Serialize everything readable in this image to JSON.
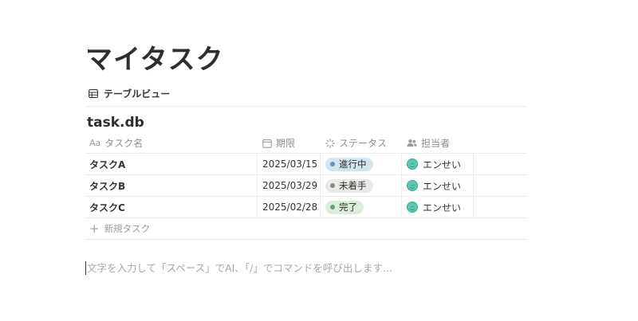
{
  "page": {
    "title": "マイタスク",
    "placeholder": "文字を入力して「スペース」でAI、「/」でコマンドを呼び出します..."
  },
  "view": {
    "tab_label": "テーブルビュー",
    "tab_icon": "table-icon"
  },
  "database": {
    "title": "task.db",
    "columns": [
      {
        "label": "タスク名",
        "icon": "Aa"
      },
      {
        "label": "期限",
        "icon": "calendar-icon"
      },
      {
        "label": "ステータス",
        "icon": "status-icon"
      },
      {
        "label": "担当者",
        "icon": "people-icon"
      }
    ],
    "rows": [
      {
        "name": "タスクA",
        "due": "2025/03/15",
        "status": "進行中",
        "owner": "エンせい"
      },
      {
        "name": "タスクB",
        "due": "2025/03/29",
        "status": "未着手",
        "owner": "エンせい"
      },
      {
        "name": "タスクC",
        "due": "2025/02/28",
        "status": "完了",
        "owner": "エンせい"
      }
    ],
    "new_row_label": "新規タスク"
  },
  "status_colors": {
    "進行中": {
      "bg": "#d3e5ef",
      "dot": "#5b97bd"
    },
    "未着手": {
      "bg": "#e9e9e7",
      "dot": "#8a8985"
    },
    "完了": {
      "bg": "#dbeddb",
      "dot": "#6c9b7d"
    }
  }
}
